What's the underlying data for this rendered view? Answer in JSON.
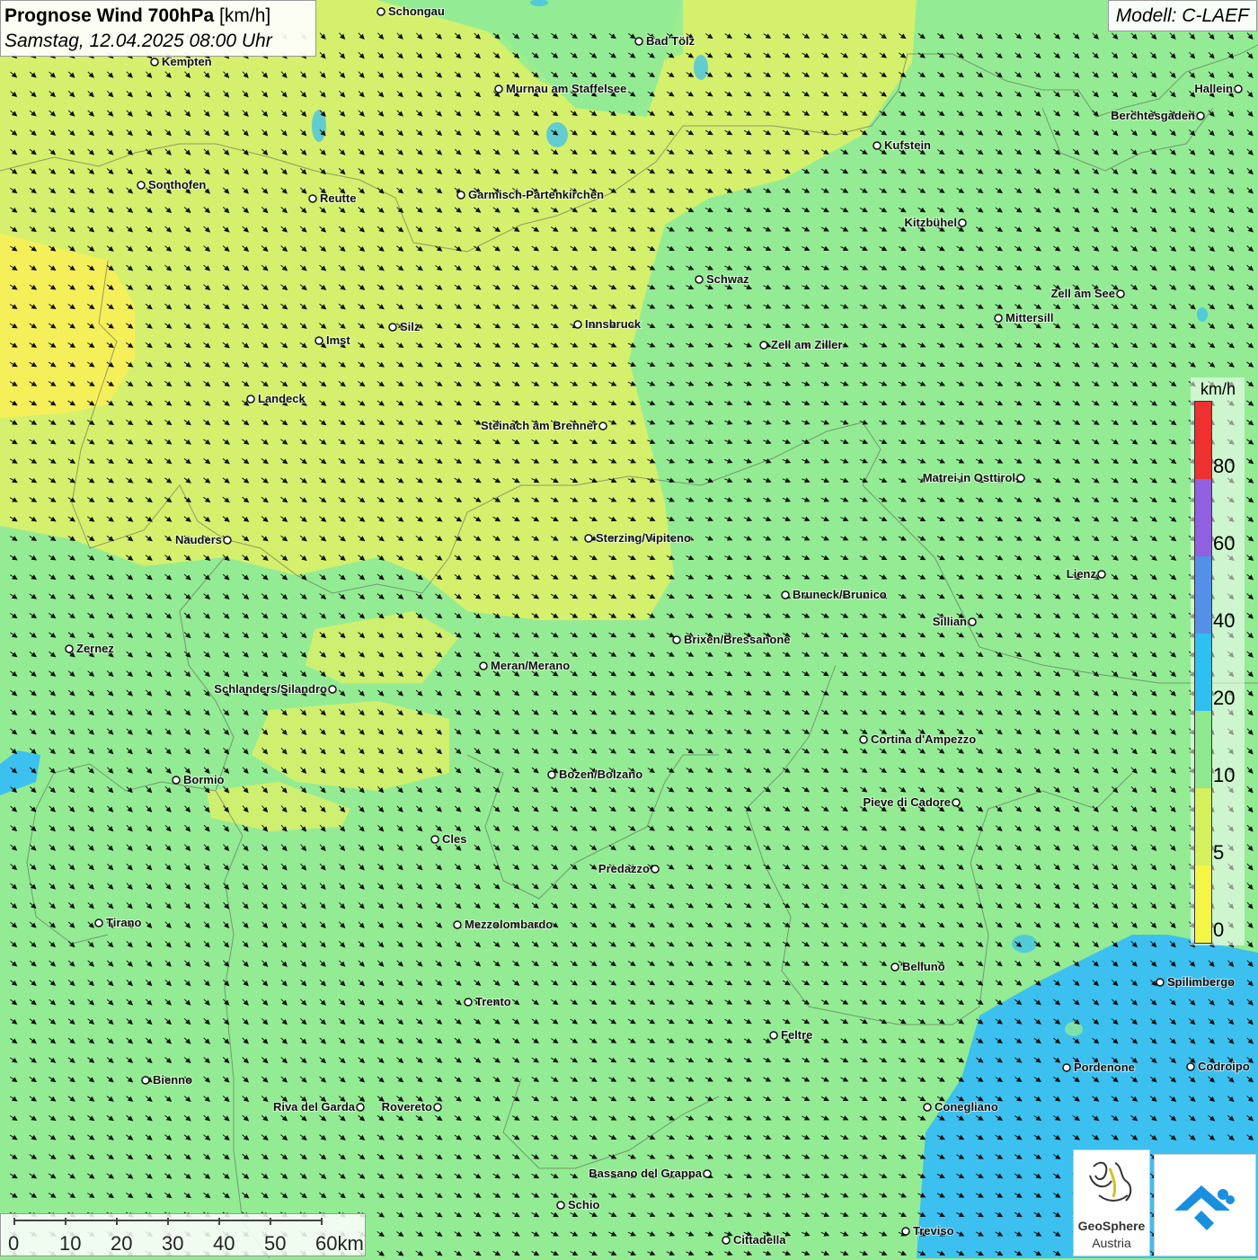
{
  "header": {
    "title_bold": "Prognose Wind 700hPa",
    "title_unit": "[km/h]",
    "datetime": "Samstag, 12.04.2025 08:00 Uhr",
    "model": "Modell: C-LAEF"
  },
  "legend": {
    "unit": "km/h",
    "levels": [
      {
        "label": "0",
        "color": "#f5f545"
      },
      {
        "label": "5",
        "color": "#d4f05c"
      },
      {
        "label": "10",
        "color": "#8ee88e"
      },
      {
        "label": "20",
        "color": "#2ec0f0"
      },
      {
        "label": "40",
        "color": "#5590e8"
      },
      {
        "label": "60",
        "color": "#9060e0"
      },
      {
        "label": "80",
        "color": "#ee3030"
      }
    ]
  },
  "scale_bar": {
    "labels": [
      "0",
      "10",
      "20",
      "30",
      "40",
      "50",
      "60km"
    ]
  },
  "colors": {
    "light_green": "#93ec93",
    "yellow_green": "#d8f06a",
    "yellow": "#f5f05a",
    "blue": "#3cc0f0"
  },
  "cities": [
    {
      "name": "Schongau"
    },
    {
      "name": "Bad Tölz"
    },
    {
      "name": "Kempten"
    },
    {
      "name": "Hallein"
    },
    {
      "name": "Murnau am Staffelsee"
    },
    {
      "name": "Berchtesgaden"
    },
    {
      "name": "Kufstein"
    },
    {
      "name": "Sonthofen"
    },
    {
      "name": "Reutte"
    },
    {
      "name": "Garmisch-Partenkirchen"
    },
    {
      "name": "Kitzbühel"
    },
    {
      "name": "Schwaz"
    },
    {
      "name": "Zell am See"
    },
    {
      "name": "Mittersill"
    },
    {
      "name": "Innsbruck"
    },
    {
      "name": "Silz"
    },
    {
      "name": "Imst"
    },
    {
      "name": "Zell am Ziller"
    },
    {
      "name": "Landeck"
    },
    {
      "name": "Steinach am Brenner"
    },
    {
      "name": "Matrei in Osttirol"
    },
    {
      "name": "Nauders"
    },
    {
      "name": "Sterzing/Vipiteno"
    },
    {
      "name": "Lienz"
    },
    {
      "name": "Bruneck/Brunico"
    },
    {
      "name": "Sillian"
    },
    {
      "name": "Brixen/Bressanone"
    },
    {
      "name": "Zernez"
    },
    {
      "name": "Meran/Merano"
    },
    {
      "name": "Schlanders/Silandro"
    },
    {
      "name": "Cortina d'Ampezzo"
    },
    {
      "name": "Bozen/Bolzano"
    },
    {
      "name": "Bormio"
    },
    {
      "name": "Pieve di Cadore"
    },
    {
      "name": "Cles"
    },
    {
      "name": "Predazzo"
    },
    {
      "name": "Tirano"
    },
    {
      "name": "Mezzolombardo"
    },
    {
      "name": "Belluno"
    },
    {
      "name": "Spilimbergo"
    },
    {
      "name": "Trento"
    },
    {
      "name": "Feltre"
    },
    {
      "name": "Bienno"
    },
    {
      "name": "Pordenone"
    },
    {
      "name": "Codroipo"
    },
    {
      "name": "Riva del Garda"
    },
    {
      "name": "Rovereto"
    },
    {
      "name": "Conegliano"
    },
    {
      "name": "Bassano del Grappa"
    },
    {
      "name": "Schio"
    },
    {
      "name": "Treviso"
    },
    {
      "name": "Cittadella"
    }
  ],
  "logos": {
    "geosphere_line1": "GeoSphere",
    "geosphere_line2": "Austria"
  }
}
